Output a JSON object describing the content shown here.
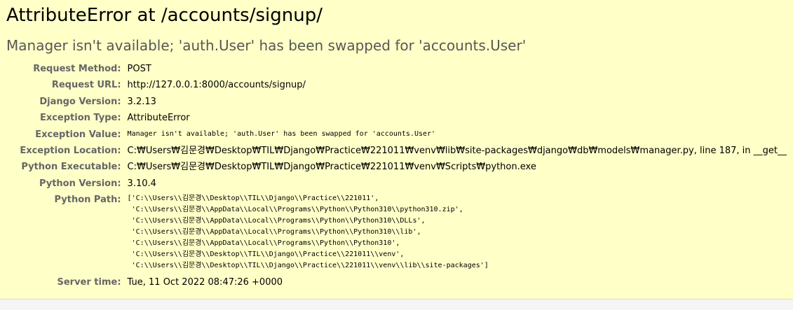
{
  "error": {
    "title": "AttributeError at /accounts/signup/",
    "value": "Manager isn't available; 'auth.User' has been swapped for 'accounts.User'"
  },
  "meta": [
    {
      "label": "Request Method:",
      "value": "POST"
    },
    {
      "label": "Request URL:",
      "value": "http://127.0.0.1:8000/accounts/signup/"
    },
    {
      "label": "Django Version:",
      "value": "3.2.13"
    },
    {
      "label": "Exception Type:",
      "value": "AttributeError"
    },
    {
      "label": "Exception Value:",
      "value": "Manager isn't available; 'auth.User' has been swapped for 'accounts.User'"
    },
    {
      "label": "Exception Location:",
      "value": "C:₩Users₩김문경₩Desktop₩TIL₩Django₩Practice₩221011₩venv₩lib₩site-packages₩django₩db₩models₩manager.py, line 187, in __get__"
    },
    {
      "label": "Python Executable:",
      "value": "C:₩Users₩김문경₩Desktop₩TIL₩Django₩Practice₩221011₩venv₩Scripts₩python.exe"
    },
    {
      "label": "Python Version:",
      "value": "3.10.4"
    },
    {
      "label": "Python Path:",
      "value": ""
    },
    {
      "label": "Server time:",
      "value": "Tue, 11 Oct 2022 08:47:26 +0000"
    }
  ],
  "python_path": [
    "['C:\\\\Users\\\\김문경\\\\Desktop\\\\TIL\\\\Django\\\\Practice\\\\221011',",
    " 'C:\\\\Users\\\\김문경\\\\AppData\\\\Local\\\\Programs\\\\Python\\\\Python310\\\\python310.zip',",
    " 'C:\\\\Users\\\\김문경\\\\AppData\\\\Local\\\\Programs\\\\Python\\\\Python310\\\\DLLs',",
    " 'C:\\\\Users\\\\김문경\\\\AppData\\\\Local\\\\Programs\\\\Python\\\\Python310\\\\lib',",
    " 'C:\\\\Users\\\\김문경\\\\AppData\\\\Local\\\\Programs\\\\Python\\\\Python310',",
    " 'C:\\\\Users\\\\김문경\\\\Desktop\\\\TIL\\\\Django\\\\Practice\\\\221011\\\\venv',",
    " 'C:\\\\Users\\\\김문경\\\\Desktop\\\\TIL\\\\Django\\\\Practice\\\\221011\\\\venv\\\\lib\\\\site-packages']"
  ]
}
